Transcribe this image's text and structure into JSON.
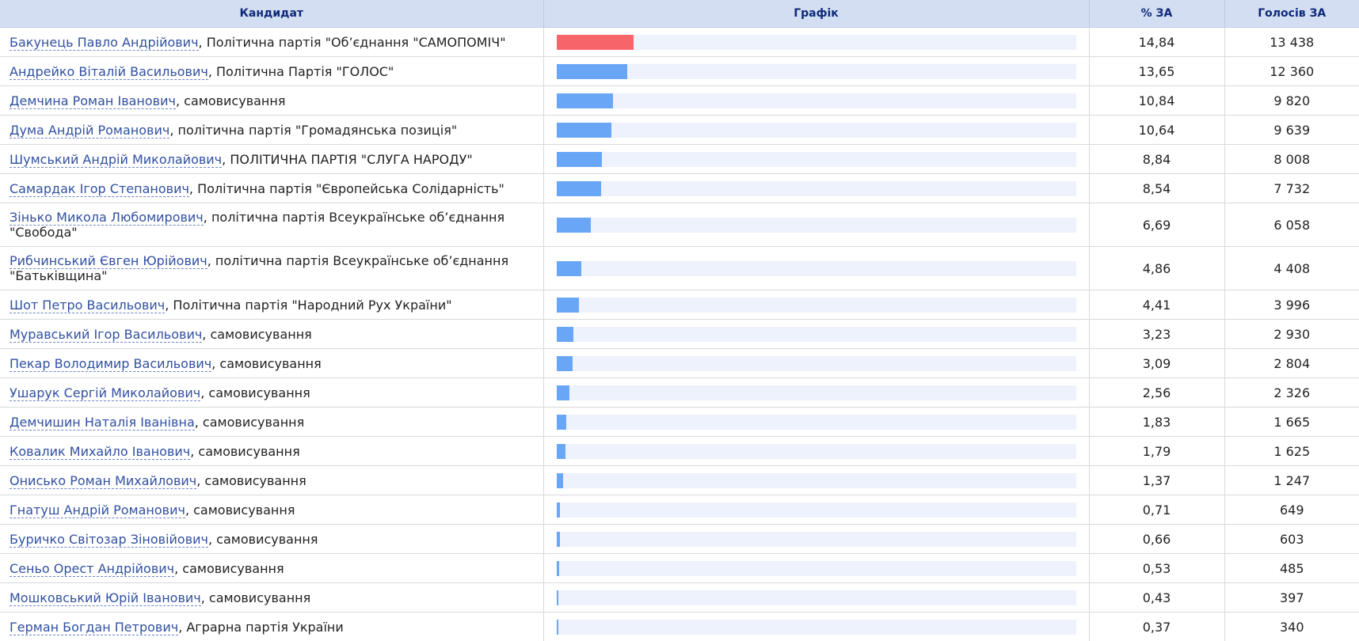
{
  "table": {
    "headers": {
      "candidate": "Кандидат",
      "chart": "Графік",
      "percent": "% ЗА",
      "votes": "Голосів ЗА"
    },
    "rows": [
      {
        "name": "Бакунець Павло Андрійович",
        "affiliation": ", Політична партія \"Об’єднання \"САМОПОМІЧ\"",
        "percent": "14,84",
        "votes": "13 438",
        "share": 14.84,
        "highlight": true
      },
      {
        "name": "Андрейко Віталій Васильович",
        "affiliation": ", Політична Партія \"ГОЛОС\"",
        "percent": "13,65",
        "votes": "12 360",
        "share": 13.65
      },
      {
        "name": "Демчина Роман Іванович",
        "affiliation": ", самовисування",
        "percent": "10,84",
        "votes": "9 820",
        "share": 10.84
      },
      {
        "name": "Дума Андрій Романович",
        "affiliation": ", політична партія \"Громадянська позиція\"",
        "percent": "10,64",
        "votes": "9 639",
        "share": 10.64
      },
      {
        "name": "Шумський Андрій Миколайович",
        "affiliation": ", ПОЛІТИЧНА ПАРТІЯ \"СЛУГА НАРОДУ\"",
        "percent": "8,84",
        "votes": "8 008",
        "share": 8.84
      },
      {
        "name": "Самардак Ігор Степанович",
        "affiliation": ", Політична партія \"Європейська Солідарність\"",
        "percent": "8,54",
        "votes": "7 732",
        "share": 8.54
      },
      {
        "name": "Зінько Микола Любомирович",
        "affiliation": ", політична партія Всеукраїнське об’єднання \"Свобода\"",
        "percent": "6,69",
        "votes": "6 058",
        "share": 6.69,
        "double": true
      },
      {
        "name": "Рибчинський Євген Юрійович",
        "affiliation": ", політична партія Всеукраїнське об’єднання \"Батьківщина\"",
        "percent": "4,86",
        "votes": "4 408",
        "share": 4.86,
        "double": true
      },
      {
        "name": "Шот Петро Васильович",
        "affiliation": ", Політична партія \"Народний Рух України\"",
        "percent": "4,41",
        "votes": "3 996",
        "share": 4.41
      },
      {
        "name": "Муравський Ігор Васильович",
        "affiliation": ", самовисування",
        "percent": "3,23",
        "votes": "2 930",
        "share": 3.23
      },
      {
        "name": "Пекар Володимир Васильович",
        "affiliation": ", самовисування",
        "percent": "3,09",
        "votes": "2 804",
        "share": 3.09
      },
      {
        "name": "Ушарук Сергій Миколайович",
        "affiliation": ", самовисування",
        "percent": "2,56",
        "votes": "2 326",
        "share": 2.56
      },
      {
        "name": "Демчишин Наталія Іванівна",
        "affiliation": ", самовисування",
        "percent": "1,83",
        "votes": "1 665",
        "share": 1.83
      },
      {
        "name": "Ковалик Михайло Іванович",
        "affiliation": ", самовисування",
        "percent": "1,79",
        "votes": "1 625",
        "share": 1.79
      },
      {
        "name": "Онисько Роман Михайлович",
        "affiliation": ", самовисування",
        "percent": "1,37",
        "votes": "1 247",
        "share": 1.37
      },
      {
        "name": "Гнатуш Андрій Романович",
        "affiliation": ", самовисування",
        "percent": "0,71",
        "votes": "649",
        "share": 0.71
      },
      {
        "name": "Буричко Світозар Зіновійович",
        "affiliation": ", самовисування",
        "percent": "0,66",
        "votes": "603",
        "share": 0.66
      },
      {
        "name": "Сеньо Орест Андрійович",
        "affiliation": ", самовисування",
        "percent": "0,53",
        "votes": "485",
        "share": 0.53
      },
      {
        "name": "Мошковський Юрій Іванович",
        "affiliation": ", самовисування",
        "percent": "0,43",
        "votes": "397",
        "share": 0.43
      },
      {
        "name": "Герман Богдан Петрович",
        "affiliation": ", Аграрна партія України",
        "percent": "0,37",
        "votes": "340",
        "share": 0.37
      }
    ]
  },
  "colors": {
    "header_bg": "#d4def2",
    "header_text": "#0d2a7a",
    "bar_leader": "#f7656b",
    "bar": "#6aa6f6",
    "bar_track": "#eef2fc",
    "link": "#3050a0"
  }
}
